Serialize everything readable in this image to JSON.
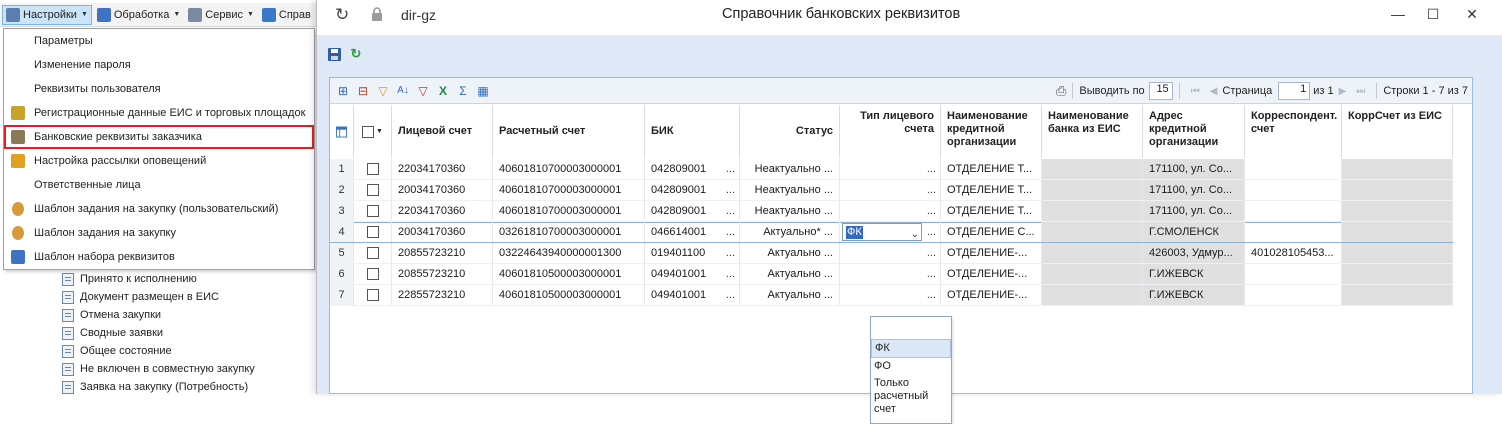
{
  "left_app": {
    "menubar": [
      {
        "label": "Настройки",
        "active": true,
        "icon": "settings-tools-icon"
      },
      {
        "label": "Обработка",
        "active": false,
        "icon": "processing-icon"
      },
      {
        "label": "Сервис",
        "active": false,
        "icon": "service-icon"
      },
      {
        "label": "Справ",
        "active": false,
        "icon": "help-icon"
      }
    ],
    "dropdown_items": [
      {
        "label": "Параметры",
        "icon": ""
      },
      {
        "label": "Изменение пароля",
        "icon": ""
      },
      {
        "label": "Реквизиты пользователя",
        "icon": ""
      },
      {
        "label": "Регистрационные данные ЕИС и торговых площадок",
        "icon": "emblem-icon"
      },
      {
        "label": "Банковские реквизиты заказчика",
        "icon": "bank-icon",
        "highlighted": true
      },
      {
        "label": "Настройка рассылки оповещений",
        "icon": "mail-settings-icon"
      },
      {
        "label": "Ответственные лица",
        "icon": ""
      },
      {
        "label": "Шаблон задания на закупку (пользовательский)",
        "icon": "user-icon"
      },
      {
        "label": "Шаблон задания на закупку",
        "icon": "user-icon"
      },
      {
        "label": "Шаблон набора реквизитов",
        "icon": "document-icon"
      }
    ],
    "tree_items": [
      "Принято к исполнению",
      "Документ размещен в ЕИС",
      "Отмена закупки",
      "Сводные заявки",
      "Общее состояние",
      "Не включен в совместную закупку",
      "Заявка на закупку (Потребность)"
    ]
  },
  "dialog": {
    "url": "dir-gz",
    "title": "Справочник банковских реквизитов",
    "pager": {
      "per_page_label": "Выводить по",
      "per_page": "15",
      "page_label": "Страница",
      "page": "1",
      "of_label": "из 1",
      "rows_label": "Строки 1 - 7 из 7"
    },
    "columns": [
      "Лицевой счет",
      "Расчетный счет",
      "БИК",
      "Статус",
      "Тип лицевого счета",
      "Наименование кредитной организации",
      "Наименование банка из ЕИС",
      "Адрес кредитной организации",
      "Корреспондент. счет",
      "КоррСчет из ЕИС"
    ],
    "rows": [
      {
        "n": "1",
        "acc": "22034170360",
        "settle": "40601810700003000001",
        "bik": "042809001",
        "status": "Неактуально",
        "type": "",
        "org": "ОТДЕЛЕНИЕ Т...",
        "bank_eis": "",
        "addr": "171100, ул. Со...",
        "corr": "",
        "corr_eis": ""
      },
      {
        "n": "2",
        "acc": "20034170360",
        "settle": "40601810700003000001",
        "bik": "042809001",
        "status": "Неактуально",
        "type": "",
        "org": "ОТДЕЛЕНИЕ Т...",
        "bank_eis": "",
        "addr": "171100, ул. Со...",
        "corr": "",
        "corr_eis": ""
      },
      {
        "n": "3",
        "acc": "22034170360",
        "settle": "40601810700003000001",
        "bik": "042809001",
        "status": "Неактуально",
        "type": "",
        "org": "ОТДЕЛЕНИЕ Т...",
        "bank_eis": "",
        "addr": "171100, ул. Со...",
        "corr": "",
        "corr_eis": ""
      },
      {
        "n": "4",
        "acc": "20034170360",
        "settle": "03261810700003000001",
        "bik": "046614001",
        "status": "Актуально*",
        "type": "ФК",
        "org": "ОТДЕЛЕНИЕ С...",
        "bank_eis": "",
        "addr": "Г.СМОЛЕНСК",
        "corr": "",
        "corr_eis": ""
      },
      {
        "n": "5",
        "acc": "20855723210",
        "settle": "03224643940000001300",
        "bik": "019401100",
        "status": "Актуально",
        "type": "",
        "org": "ОТДЕЛЕНИЕ-...",
        "bank_eis": "",
        "addr": "426003, Удмур...",
        "corr": "401028105453...",
        "corr_eis": ""
      },
      {
        "n": "6",
        "acc": "20855723210",
        "settle": "40601810500003000001",
        "bik": "049401001",
        "status": "Актуально",
        "type": "",
        "org": "ОТДЕЛЕНИЕ-...",
        "bank_eis": "",
        "addr": "Г.ИЖЕВСК",
        "corr": "",
        "corr_eis": ""
      },
      {
        "n": "7",
        "acc": "22855723210",
        "settle": "40601810500003000001",
        "bik": "049401001",
        "status": "Актуально",
        "type": "",
        "org": "ОТДЕЛЕНИЕ-...",
        "bank_eis": "",
        "addr": "Г.ИЖЕВСК",
        "corr": "",
        "corr_eis": ""
      }
    ],
    "type_options": [
      "ФК",
      "ФО",
      "Только расчетный счет"
    ],
    "selected_type": "ФК"
  }
}
